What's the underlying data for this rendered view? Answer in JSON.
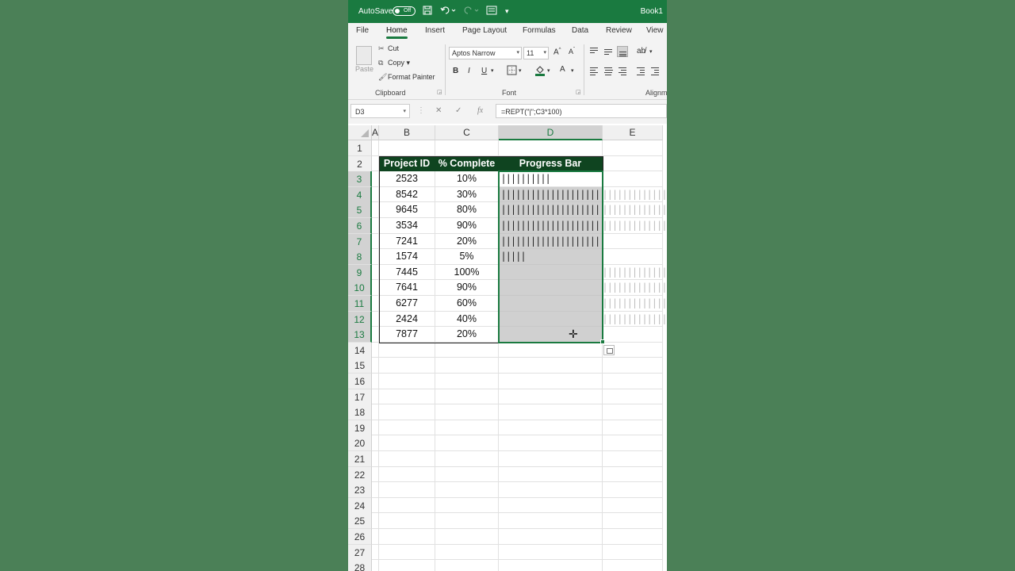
{
  "titlebar": {
    "autosave_label": "AutoSave",
    "autosave_state": "Off",
    "book_title": "Book1"
  },
  "tabs": [
    "File",
    "Home",
    "Insert",
    "Page Layout",
    "Formulas",
    "Data",
    "Review",
    "View"
  ],
  "active_tab": "Home",
  "ribbon": {
    "paste_label": "Paste",
    "cut_label": "Cut",
    "copy_label": "Copy",
    "format_painter_label": "Format Painter",
    "clipboard_label": "Clipboard",
    "font_name": "Aptos Narrow",
    "font_size": "11",
    "font_label": "Font",
    "alignment_label": "Alignm",
    "bold": "B",
    "italic": "I",
    "underline": "U"
  },
  "formula_bar": {
    "name_box": "D3",
    "formula": "=REPT(\"|\";C3*100)",
    "fx": "fx"
  },
  "columns": [
    "A",
    "B",
    "C",
    "D",
    "E"
  ],
  "selected_column": "D",
  "row_numbers": [
    "1",
    "2",
    "3",
    "4",
    "5",
    "6",
    "7",
    "8",
    "9",
    "10",
    "11",
    "12",
    "13",
    "14",
    "15",
    "16",
    "17",
    "18",
    "19",
    "20",
    "21",
    "22",
    "23",
    "24",
    "25",
    "26",
    "27",
    "28"
  ],
  "table": {
    "headers": [
      "Project ID",
      "% Complete",
      "Progress Bar"
    ],
    "rows": [
      {
        "id": "2523",
        "pct": "10%",
        "progress": 0.1
      },
      {
        "id": "8542",
        "pct": "30%",
        "progress": 0.3
      },
      {
        "id": "9645",
        "pct": "80%",
        "progress": 0.8
      },
      {
        "id": "3534",
        "pct": "90%",
        "progress": 0.9
      },
      {
        "id": "7241",
        "pct": "20%",
        "progress": 0.2
      },
      {
        "id": "1574",
        "pct": "5%",
        "progress": 0.05
      },
      {
        "id": "7445",
        "pct": "100%",
        "progress": 1.0
      },
      {
        "id": "7641",
        "pct": "90%",
        "progress": 0.9
      },
      {
        "id": "6277",
        "pct": "60%",
        "progress": 0.6
      },
      {
        "id": "2424",
        "pct": "40%",
        "progress": 0.4
      },
      {
        "id": "7877",
        "pct": "20%",
        "progress": 0.2
      }
    ]
  },
  "colors": {
    "accent": "#1a7a40",
    "header_fill": "#0f4420",
    "background": "#4a7d58"
  }
}
